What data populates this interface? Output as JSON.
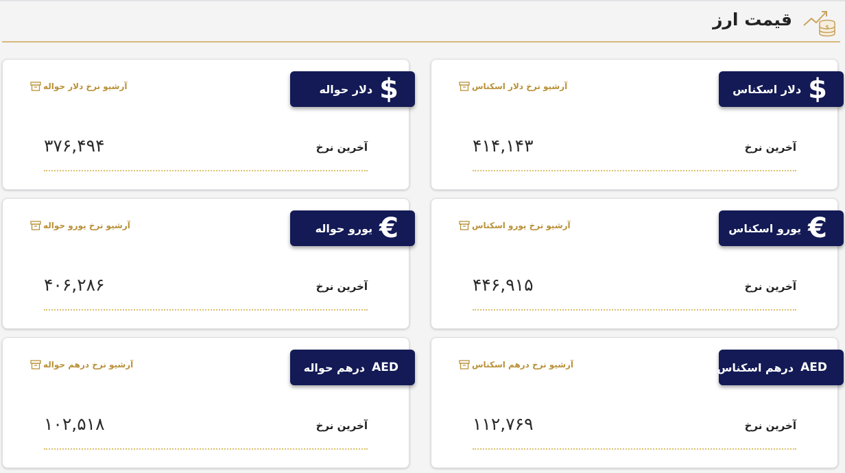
{
  "page_title": "قیمت ارز",
  "title_icon": "chart-coins-icon",
  "accent_color": "#b99138",
  "badge_color": "#131a55",
  "cards": [
    {
      "symbol": "$",
      "label": "دلار اسکناس",
      "archive": "آرشیو نرخ دلار اسکناس",
      "last_label": "آخرین نرخ",
      "value": "۴۱۴,۱۴۳"
    },
    {
      "symbol": "$",
      "label": "دلار حواله",
      "archive": "آرشیو نرخ دلار حواله",
      "last_label": "آخرین نرخ",
      "value": "۳۷۶,۴۹۴"
    },
    {
      "symbol": "€",
      "label": "یورو اسکناس",
      "archive": "آرشیو نرخ یورو اسکناس",
      "last_label": "آخرین نرخ",
      "value": "۴۴۶,۹۱۵"
    },
    {
      "symbol": "€",
      "label": "یورو حواله",
      "archive": "آرشیو نرخ یورو حواله",
      "last_label": "آخرین نرخ",
      "value": "۴۰۶,۲۸۶"
    },
    {
      "symbol": "AED",
      "label": "درهم اسکناس",
      "archive": "آرشیو نرخ درهم اسکناس",
      "last_label": "آخرین نرخ",
      "value": "۱۱۲,۷۶۹"
    },
    {
      "symbol": "AED",
      "label": "درهم حواله",
      "archive": "آرشیو نرخ درهم حواله",
      "last_label": "آخرین نرخ",
      "value": "۱۰۲,۵۱۸"
    }
  ]
}
